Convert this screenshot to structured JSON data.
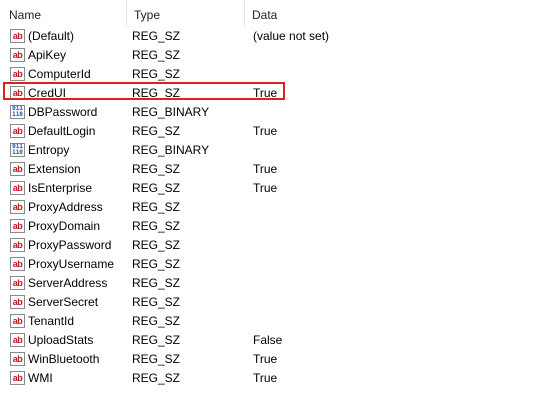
{
  "columns": {
    "name": "Name",
    "type": "Type",
    "data": "Data"
  },
  "icons": {
    "string": "ab",
    "binary": "011\n110"
  },
  "rows": [
    {
      "name": "(Default)",
      "type": "REG_SZ",
      "data": "(value not set)",
      "icon": "string-value-icon"
    },
    {
      "name": "ApiKey",
      "type": "REG_SZ",
      "data": "",
      "icon": "string-value-icon"
    },
    {
      "name": "ComputerId",
      "type": "REG_SZ",
      "data": "",
      "icon": "string-value-icon"
    },
    {
      "name": "CredUI",
      "type": "REG_SZ",
      "data": "True",
      "icon": "string-value-icon"
    },
    {
      "name": "DBPassword",
      "type": "REG_BINARY",
      "data": "",
      "icon": "binary-value-icon"
    },
    {
      "name": "DefaultLogin",
      "type": "REG_SZ",
      "data": "True",
      "icon": "string-value-icon"
    },
    {
      "name": "Entropy",
      "type": "REG_BINARY",
      "data": "",
      "icon": "binary-value-icon"
    },
    {
      "name": "Extension",
      "type": "REG_SZ",
      "data": "True",
      "icon": "string-value-icon"
    },
    {
      "name": "IsEnterprise",
      "type": "REG_SZ",
      "data": "True",
      "icon": "string-value-icon"
    },
    {
      "name": "ProxyAddress",
      "type": "REG_SZ",
      "data": "",
      "icon": "string-value-icon"
    },
    {
      "name": "ProxyDomain",
      "type": "REG_SZ",
      "data": "",
      "icon": "string-value-icon"
    },
    {
      "name": "ProxyPassword",
      "type": "REG_SZ",
      "data": "",
      "icon": "string-value-icon"
    },
    {
      "name": "ProxyUsername",
      "type": "REG_SZ",
      "data": "",
      "icon": "string-value-icon"
    },
    {
      "name": "ServerAddress",
      "type": "REG_SZ",
      "data": "",
      "icon": "string-value-icon"
    },
    {
      "name": "ServerSecret",
      "type": "REG_SZ",
      "data": "",
      "icon": "string-value-icon"
    },
    {
      "name": "TenantId",
      "type": "REG_SZ",
      "data": "",
      "icon": "string-value-icon"
    },
    {
      "name": "UploadStats",
      "type": "REG_SZ",
      "data": "False",
      "icon": "string-value-icon"
    },
    {
      "name": "WinBluetooth",
      "type": "REG_SZ",
      "data": "True",
      "icon": "string-value-icon"
    },
    {
      "name": "WMI",
      "type": "REG_SZ",
      "data": "True",
      "icon": "string-value-icon"
    }
  ],
  "highlighted_row": "CredUI",
  "colors": {
    "highlight_border": "#e02020",
    "string_icon": "#c0161c",
    "binary_icon": "#1b4fb0"
  }
}
